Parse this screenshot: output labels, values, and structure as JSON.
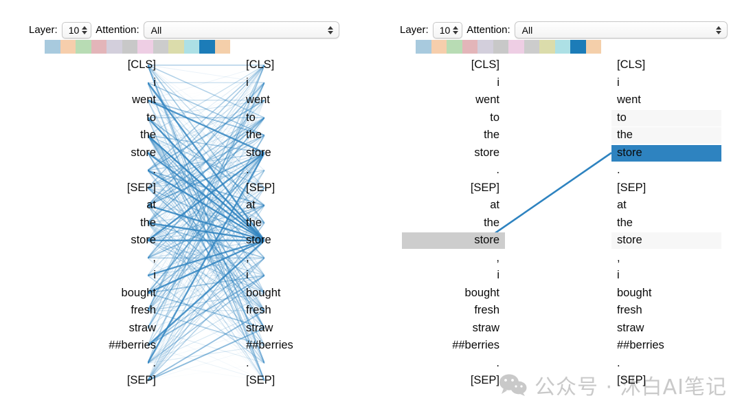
{
  "panels": [
    {
      "id": "left",
      "controls": {
        "layer_label": "Layer:",
        "layer_value": "10",
        "attention_label": "Attention:",
        "attention_value": "All"
      },
      "color_strip": [
        "#a8cade",
        "#f6ceac",
        "#b8dcb4",
        "#e3b5b9",
        "#d3cfdc",
        "#c8c8c8",
        "#eecee4",
        "#cccccc",
        "#dbdcab",
        "#ade0e5",
        "#1c7cb8",
        "#f4cfaa"
      ],
      "source_tokens": [
        "[CLS]",
        "i",
        "went",
        "to",
        "the",
        "store",
        ".",
        "[SEP]",
        "at",
        "the",
        "store",
        ",",
        "i",
        "bought",
        "fresh",
        "straw",
        "##berries",
        ".",
        "[SEP]"
      ],
      "target_tokens": [
        "[CLS]",
        "i",
        "went",
        "to",
        "the",
        "store",
        ".",
        "[SEP]",
        "at",
        "the",
        "store",
        ",",
        "i",
        "bought",
        "fresh",
        "straw",
        "##berries",
        ".",
        "[SEP]"
      ],
      "mode": "all-attention-lines"
    },
    {
      "id": "right",
      "controls": {
        "layer_label": "Layer:",
        "layer_value": "10",
        "attention_label": "Attention:",
        "attention_value": "All"
      },
      "color_strip": [
        "#a8cade",
        "#f6ceac",
        "#b8dcb4",
        "#e3b5b9",
        "#d3cfdc",
        "#c8c8c8",
        "#eecee4",
        "#cccccc",
        "#dbdcab",
        "#ade0e5",
        "#1c7cb8",
        "#f4cfaa"
      ],
      "source_tokens": [
        "[CLS]",
        "i",
        "went",
        "to",
        "the",
        "store",
        ".",
        "[SEP]",
        "at",
        "the",
        "store",
        ",",
        "i",
        "bought",
        "fresh",
        "straw",
        "##berries",
        ".",
        "[SEP]"
      ],
      "target_tokens": [
        "[CLS]",
        "i",
        "went",
        "to",
        "the",
        "store",
        ".",
        "[SEP]",
        "at",
        "the",
        "store",
        ",",
        "i",
        "bought",
        "fresh",
        "straw",
        "##berries",
        ".",
        "[SEP]"
      ],
      "selected_source_index": 10,
      "selected_source_token": "store",
      "selected_target_index": 5,
      "selected_target_token": "store",
      "mode": "single-token-attention"
    }
  ],
  "colors": {
    "selection_gray": "#cdcdcd",
    "attention_blue": "#2e83c0",
    "line_blue": "#2e83c0",
    "text": "#0a0a0a"
  },
  "watermark": {
    "icon": "wechat-icon",
    "text": "公众号 · 沐白AI笔记"
  }
}
